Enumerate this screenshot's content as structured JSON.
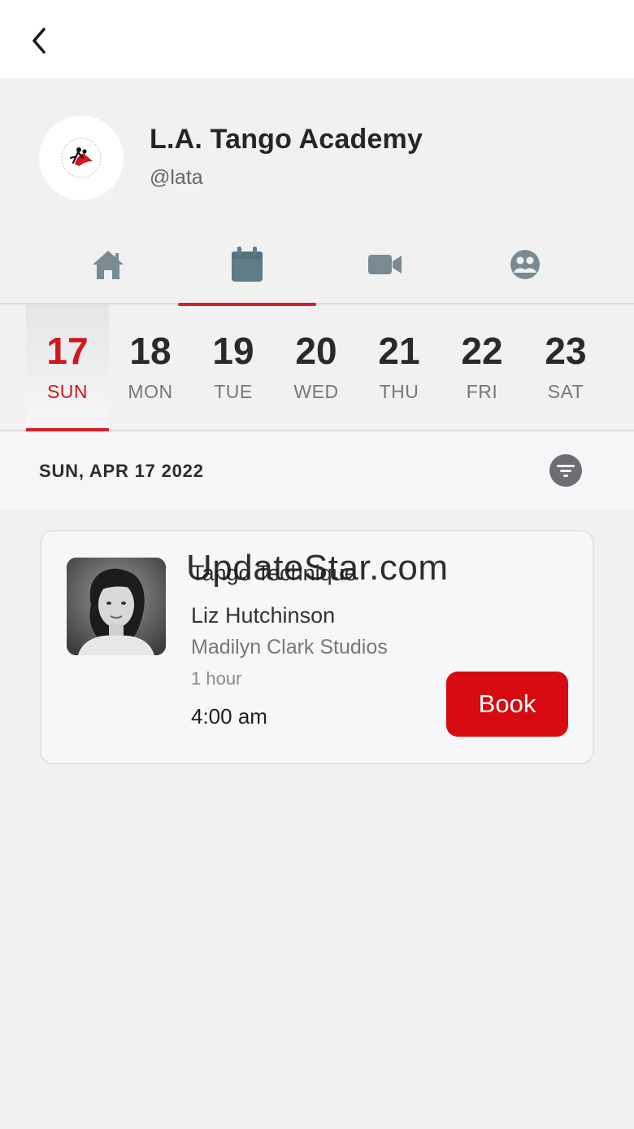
{
  "header": {
    "back_icon": "chevron-left-icon"
  },
  "profile": {
    "name": "L.A. Tango Academy",
    "handle": "@lata",
    "logo_icon": "tango-academy-logo"
  },
  "tabs": [
    {
      "icon": "home-icon",
      "active": false
    },
    {
      "icon": "calendar-icon",
      "active": true
    },
    {
      "icon": "video-camera-icon",
      "active": false
    },
    {
      "icon": "people-icon",
      "active": false
    }
  ],
  "days": [
    {
      "num": "17",
      "name": "SUN",
      "selected": true
    },
    {
      "num": "18",
      "name": "MON",
      "selected": false
    },
    {
      "num": "19",
      "name": "TUE",
      "selected": false
    },
    {
      "num": "20",
      "name": "WED",
      "selected": false
    },
    {
      "num": "21",
      "name": "THU",
      "selected": false
    },
    {
      "num": "22",
      "name": "FRI",
      "selected": false
    },
    {
      "num": "23",
      "name": "SAT",
      "selected": false
    }
  ],
  "schedule": {
    "date_label": "SUN, APR 17 2022",
    "filter_icon": "filter-icon",
    "classes": [
      {
        "title": "Tango Technique",
        "instructor": "Liz Hutchinson",
        "studio": "Madilyn Clark Studios",
        "duration": "1 hour",
        "time": "4:00 am",
        "book_label": "Book"
      }
    ]
  },
  "watermark": "UpdateStar.com",
  "colors": {
    "accent": "#d61f26",
    "book": "#d60a10",
    "tab_icon": "#7a8a92",
    "tab_icon_active": "#5f7b86"
  }
}
